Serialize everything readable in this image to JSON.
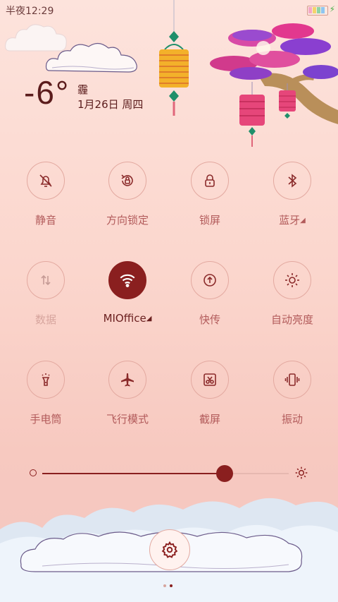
{
  "status_bar": {
    "time": "半夜12:29"
  },
  "weather": {
    "temperature": "-6°",
    "condition": "霾",
    "date": "1月26日 周四"
  },
  "tiles": [
    {
      "name": "mute-toggle",
      "icon": "bell-off-icon",
      "label": "静音",
      "active": false,
      "dim": false
    },
    {
      "name": "rotation-lock-toggle",
      "icon": "rotation-lock-icon",
      "label": "方向锁定",
      "active": false,
      "dim": false
    },
    {
      "name": "lock-screen-button",
      "icon": "lock-icon",
      "label": "锁屏",
      "active": false,
      "dim": false
    },
    {
      "name": "bluetooth-toggle",
      "icon": "bluetooth-icon",
      "label": "蓝牙",
      "active": false,
      "dim": false,
      "has_menu": true
    },
    {
      "name": "mobile-data-toggle",
      "icon": "data-arrows-icon",
      "label": "数据",
      "active": false,
      "dim": true
    },
    {
      "name": "wifi-toggle",
      "icon": "wifi-icon",
      "label": "MIOffice",
      "active": true,
      "dim": false,
      "has_menu": true
    },
    {
      "name": "quick-share-toggle",
      "icon": "upload-icon",
      "label": "快传",
      "active": false,
      "dim": false
    },
    {
      "name": "auto-brightness-toggle",
      "icon": "sun-icon",
      "label": "自动亮度",
      "active": false,
      "dim": false
    },
    {
      "name": "flashlight-toggle",
      "icon": "flashlight-icon",
      "label": "手电筒",
      "active": false,
      "dim": false
    },
    {
      "name": "airplane-mode-toggle",
      "icon": "airplane-icon",
      "label": "飞行模式",
      "active": false,
      "dim": false
    },
    {
      "name": "screenshot-button",
      "icon": "scissors-icon",
      "label": "截屏",
      "active": false,
      "dim": false
    },
    {
      "name": "vibrate-toggle",
      "icon": "vibrate-icon",
      "label": "振动",
      "active": false,
      "dim": false
    }
  ],
  "brightness": {
    "value": 0.74
  },
  "pager": {
    "pages": 2,
    "current": 2
  },
  "colors": {
    "accent": "#8a1f1f",
    "label": "#b25b5b",
    "background_top": "#fde3dc",
    "background_bottom": "#f3c6c1"
  }
}
